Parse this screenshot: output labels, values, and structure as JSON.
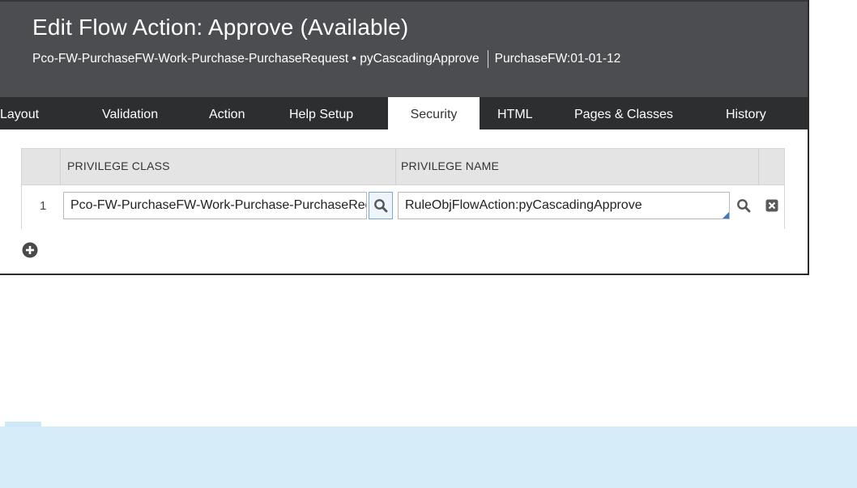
{
  "header": {
    "title": "Edit Flow Action: Approve (Available)",
    "class_name": "Pco-FW-PurchaseFW-Work-Purchase-PurchaseRequest",
    "bullet": "•",
    "rule_name": "pyCascadingApprove",
    "ruleset": "PurchaseFW:01-01-12"
  },
  "tabs": [
    {
      "label": "Layout"
    },
    {
      "label": "Validation"
    },
    {
      "label": "Action"
    },
    {
      "label": "Help Setup"
    },
    {
      "label": "Security",
      "active": true
    },
    {
      "label": "HTML"
    },
    {
      "label": "Pages & Classes"
    },
    {
      "label": "History"
    }
  ],
  "privileges": {
    "columns": [
      "PRIVILEGE CLASS",
      "PRIVILEGE NAME"
    ],
    "rows": [
      {
        "index": "1",
        "privilege_class": "Pco-FW-PurchaseFW-Work-Purchase-PurchaseRequest",
        "privilege_name": "RuleObjFlowAction:pyCascadingApprove"
      }
    ]
  },
  "icons": {
    "lookup": "search-icon",
    "delete": "close-box-icon",
    "add": "plus-circle-icon"
  },
  "colors": {
    "header_bg": "#4b4d50",
    "tabbar_bg": "#2d2e30",
    "accent": "#3d7ac1",
    "footer_bg": "#d7ecf9"
  }
}
